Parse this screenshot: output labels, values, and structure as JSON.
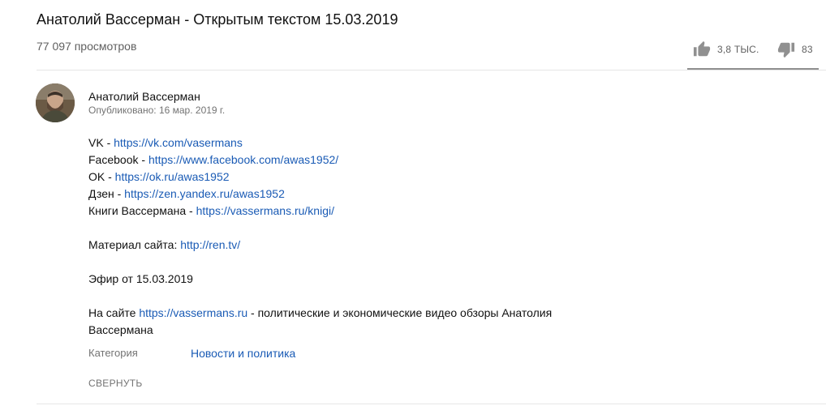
{
  "video": {
    "title": "Анатолий Вассерман - Открытым текстом 15.03.2019",
    "views": "77 097 просмотров",
    "likes": "3,8 ТЫС.",
    "dislikes": "83",
    "like_ratio": 0.98
  },
  "channel": {
    "name": "Анатолий Вассерман",
    "published": "Опубликовано: 16 мар. 2019 г."
  },
  "description": {
    "vk_prefix": "VK - ",
    "vk_link": "https://vk.com/vasermans",
    "fb_prefix": "Facebook - ",
    "fb_link": "https://www.facebook.com/awas1952/",
    "ok_prefix": "OK - ",
    "ok_link": "https://ok.ru/awas1952",
    "zen_prefix": "Дзен - ",
    "zen_link": "https://zen.yandex.ru/awas1952",
    "books_prefix": "Книги Вассермана - ",
    "books_link": "https://vassermans.ru/knigi/",
    "material_prefix": "Материал сайта: ",
    "material_link": "http://ren.tv/",
    "air": "Эфир от 15.03.2019",
    "site_prefix": "На сайте ",
    "site_link": "https://vassermans.ru",
    "site_suffix": " - политические и экономические видео обзоры Анатолия",
    "site_suffix_2": "Вассермана"
  },
  "category": {
    "label": "Категория",
    "value": "Новости и политика"
  },
  "collapse_label": "СВЕРНУТЬ",
  "icons": {
    "like": "thumbs-up-icon",
    "dislike": "thumbs-down-icon"
  },
  "colors": {
    "link": "#1a5bb5",
    "secondary_text": "#606060",
    "icon": "#909090"
  }
}
